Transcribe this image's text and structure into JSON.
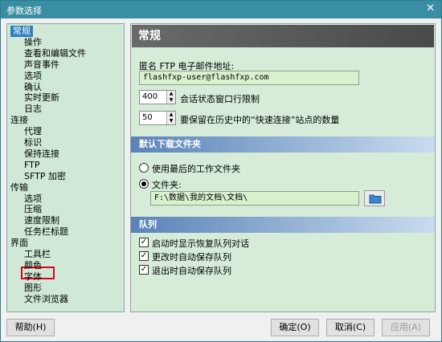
{
  "window": {
    "title": "参数选择",
    "close_glyph": "✕"
  },
  "tree": {
    "items": [
      {
        "label": "常规",
        "level": 0,
        "selected": true
      },
      {
        "label": "操作",
        "level": 1
      },
      {
        "label": "查看和编辑文件",
        "level": 1
      },
      {
        "label": "声音事件",
        "level": 1
      },
      {
        "label": "选项",
        "level": 1
      },
      {
        "label": "确认",
        "level": 1
      },
      {
        "label": "实时更新",
        "level": 1
      },
      {
        "label": "日志",
        "level": 1
      },
      {
        "label": "连接",
        "level": 0
      },
      {
        "label": "代理",
        "level": 1
      },
      {
        "label": "标识",
        "level": 1
      },
      {
        "label": "保持连接",
        "level": 1
      },
      {
        "label": "FTP",
        "level": 1
      },
      {
        "label": "SFTP 加密",
        "level": 1
      },
      {
        "label": "传输",
        "level": 0
      },
      {
        "label": "选项",
        "level": 1
      },
      {
        "label": "压缩",
        "level": 1
      },
      {
        "label": "速度限制",
        "level": 1
      },
      {
        "label": "任务栏标题",
        "level": 1
      },
      {
        "label": "界面",
        "level": 0
      },
      {
        "label": "工具栏",
        "level": 1
      },
      {
        "label": "颜色",
        "level": 1
      },
      {
        "label": "字体",
        "level": 1,
        "highlighted": true
      },
      {
        "label": "图形",
        "level": 1
      },
      {
        "label": "文件浏览器",
        "level": 1
      }
    ]
  },
  "panel": {
    "header": "常规",
    "email_label": "匿名 FTP 电子邮件地址:",
    "email_value": "flashfxp-user@flashfxp.com",
    "session_value": "400",
    "session_label": "会话状态窗口行限制",
    "history_value": "50",
    "history_label": "要保留在历史中的“快速连接”站点的数量",
    "download_section": "默认下载文件夹",
    "radio_last": "使用最后的工作文件夹",
    "radio_folder": "文件夹:",
    "folder_value": "F:\\数据\\我的文档\\文档\\",
    "queue_section": "队列",
    "checks": [
      "启动时显示恢复队列对话",
      "更改时自动保存队列",
      "退出时自动保存队列"
    ]
  },
  "buttons": {
    "help": "帮助(H)",
    "ok": "确定(O)",
    "cancel": "取消(C)",
    "apply": "应用(A)"
  },
  "colors": {
    "tree_bg": "#cfe9d6",
    "title_bar": "#3a8ea3",
    "selection": "#2f7fbf",
    "highlight_box": "#e0001b"
  }
}
